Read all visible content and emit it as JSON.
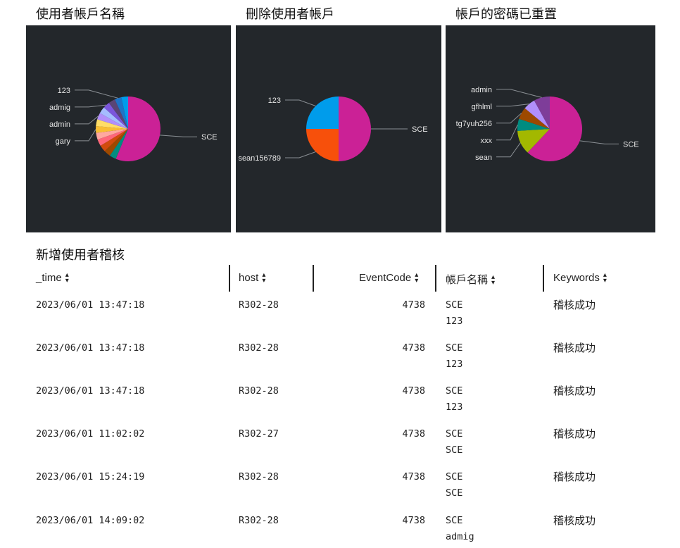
{
  "panels": [
    {
      "title": "使用者帳戶名稱",
      "slices": [
        {
          "label": "SCE",
          "value": 50,
          "color": "#cb2196"
        },
        {
          "label": "",
          "value": 3,
          "color": "#008c80"
        },
        {
          "label": "",
          "value": 3,
          "color": "#9d4900"
        },
        {
          "label": "",
          "value": 3,
          "color": "#d14b0d"
        },
        {
          "label": "",
          "value": 3,
          "color": "#ff677b"
        },
        {
          "label": "",
          "value": 3,
          "color": "#ffa8a0"
        },
        {
          "label": "gary",
          "value": 3,
          "color": "#f8be34"
        },
        {
          "label": "",
          "value": 3,
          "color": "#ffdd66"
        },
        {
          "label": "admin",
          "value": 3,
          "color": "#b18ffb"
        },
        {
          "label": "",
          "value": 3,
          "color": "#a5bcff"
        },
        {
          "label": "admig",
          "value": 3,
          "color": "#7b56db"
        },
        {
          "label": "",
          "value": 3,
          "color": "#5a4575"
        },
        {
          "label": "123",
          "value": 3,
          "color": "#1e73c6"
        },
        {
          "label": "",
          "value": 3,
          "color": "#009ceb"
        }
      ]
    },
    {
      "title": "刪除使用者帳戶",
      "slices": [
        {
          "label": "SCE",
          "value": 50,
          "color": "#cb2196"
        },
        {
          "label": "sean156789",
          "value": 25,
          "color": "#f7500b"
        },
        {
          "label": "123",
          "value": 25,
          "color": "#009ceb"
        }
      ]
    },
    {
      "title": "帳戶的密碼已重置",
      "slices": [
        {
          "label": "SCE",
          "value": 62,
          "color": "#cb2196"
        },
        {
          "label": "sean",
          "value": 12,
          "color": "#a3b800"
        },
        {
          "label": "xxx",
          "value": 6,
          "color": "#008c80"
        },
        {
          "label": "tg7yuh256",
          "value": 6,
          "color": "#9d4900"
        },
        {
          "label": "gfhlml",
          "value": 6,
          "color": "#b18ffb"
        },
        {
          "label": "admin",
          "value": 8,
          "color": "#7e3d99"
        }
      ]
    }
  ],
  "audit": {
    "title": "新增使用者稽核",
    "sort_icon": "sort-arrows-icon",
    "columns": [
      "_time",
      "host",
      "EventCode",
      "帳戶名稱",
      "Keywords"
    ],
    "rows": [
      {
        "time": "2023/06/01 13:47:18",
        "host": "R302-28",
        "code": "4738",
        "acct1": "SCE",
        "acct2": "123",
        "kw": "稽核成功"
      },
      {
        "time": "2023/06/01 13:47:18",
        "host": "R302-28",
        "code": "4738",
        "acct1": "SCE",
        "acct2": "123",
        "kw": "稽核成功"
      },
      {
        "time": "2023/06/01 13:47:18",
        "host": "R302-28",
        "code": "4738",
        "acct1": "SCE",
        "acct2": "123",
        "kw": "稽核成功"
      },
      {
        "time": "2023/06/01 11:02:02",
        "host": "R302-27",
        "code": "4738",
        "acct1": "SCE",
        "acct2": "SCE",
        "kw": "稽核成功"
      },
      {
        "time": "2023/06/01 15:24:19",
        "host": "R302-28",
        "code": "4738",
        "acct1": "SCE",
        "acct2": "SCE",
        "kw": "稽核成功"
      },
      {
        "time": "2023/06/01 14:09:02",
        "host": "R302-28",
        "code": "4738",
        "acct1": "SCE",
        "acct2": "admig",
        "kw": "稽核成功"
      }
    ]
  }
}
